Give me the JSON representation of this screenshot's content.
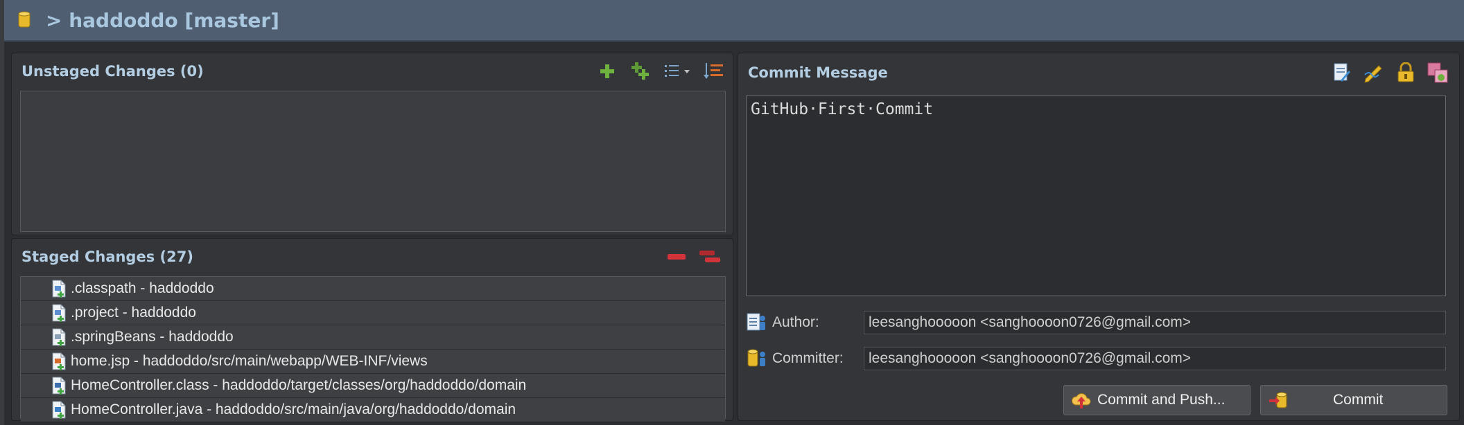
{
  "window": {
    "title": "> haddoddo [master]"
  },
  "unstaged": {
    "title": "Unstaged Changes (0)",
    "files": []
  },
  "staged": {
    "title": "Staged Changes (27)",
    "files": [
      {
        "name": ".classpath - haddoddo",
        "icon": "xml-file-added-icon"
      },
      {
        "name": ".project - haddoddo",
        "icon": "xml-file-added-icon"
      },
      {
        "name": ".springBeans - haddoddo",
        "icon": "text-file-added-icon"
      },
      {
        "name": "home.jsp - haddoddo/src/main/webapp/WEB-INF/views",
        "icon": "jsp-file-added-icon"
      },
      {
        "name": "HomeController.class - haddoddo/target/classes/org/haddoddo/domain",
        "icon": "class-file-added-icon"
      },
      {
        "name": "HomeController.java - haddoddo/src/main/java/org/haddoddo/domain",
        "icon": "java-file-added-icon"
      }
    ]
  },
  "commit": {
    "title": "Commit Message",
    "message": "GitHub·First·Commit",
    "author_label": "Author:",
    "author_value": "leesanghooooon <sanghoooon0726@gmail.com>",
    "committer_label": "Committer:",
    "committer_value": "leesanghooooon <sanghoooon0726@gmail.com>",
    "commit_push_label": "Commit and Push...",
    "commit_label": "Commit"
  },
  "colors": {
    "titlebar": "#4f5e70",
    "panel": "#333538",
    "accent_text": "#b3cde3",
    "green": "#6fb13f",
    "red": "#d0343a"
  }
}
